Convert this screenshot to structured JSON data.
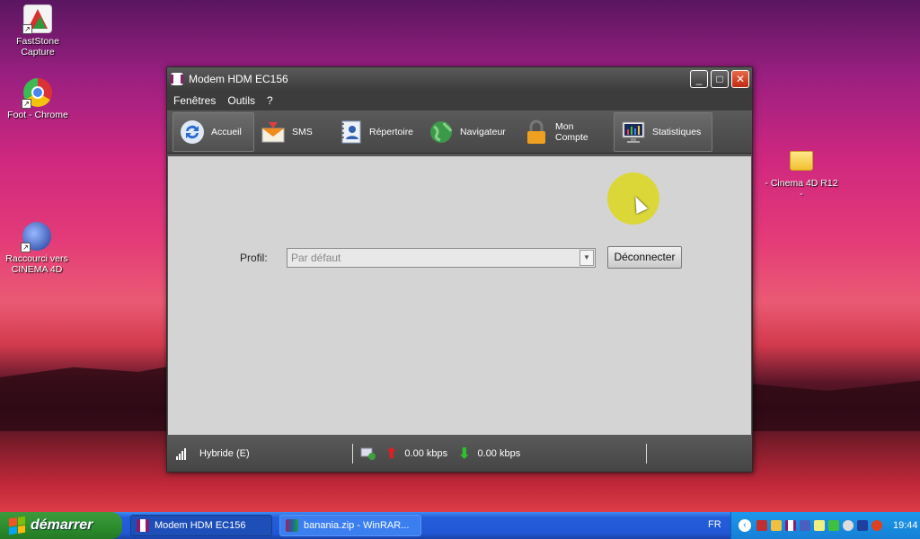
{
  "desktop": {
    "icons": [
      {
        "label": "FastStone\nCapture",
        "line1": "FastStone",
        "line2": "Capture"
      },
      {
        "label": "Foot - Chrome",
        "line1": "Foot - Chrome",
        "line2": ""
      },
      {
        "label": "Raccourci vers CINEMA 4D",
        "line1": "Raccourci vers",
        "line2": "CINEMA 4D"
      },
      {
        "label": "- Cinema 4D R12 -",
        "line1": "- Cinema 4D R12",
        "line2": "-"
      }
    ]
  },
  "window": {
    "title": "Modem HDM EC156",
    "menu": [
      "Fenêtres",
      "Outils",
      "?"
    ],
    "toolbar": [
      {
        "label": "Accueil",
        "icon": "refresh-icon"
      },
      {
        "label": "SMS",
        "icon": "envelope-icon"
      },
      {
        "label": "Répertoire",
        "icon": "address-book-icon"
      },
      {
        "label": "Navigateur",
        "icon": "globe-icon"
      },
      {
        "label": "Mon Compte",
        "icon": "padlock-icon"
      },
      {
        "label": "Statistiques",
        "icon": "monitor-chart-icon"
      }
    ],
    "profile_label": "Profil:",
    "profile_value": "Par défaut",
    "disconnect_label": "Déconnecter",
    "status": {
      "network": "Hybride (E)",
      "upload": "0.00 kbps",
      "download": "0.00 kbps"
    }
  },
  "taskbar": {
    "start_label": "démarrer",
    "tasks": [
      "Modem HDM EC156",
      "banania.zip - WinRAR..."
    ],
    "language": "FR",
    "clock": "19:44"
  },
  "colors": {
    "accent": "#8a1c6c",
    "taskbar": "#245edb",
    "start": "#2f8f2f"
  }
}
